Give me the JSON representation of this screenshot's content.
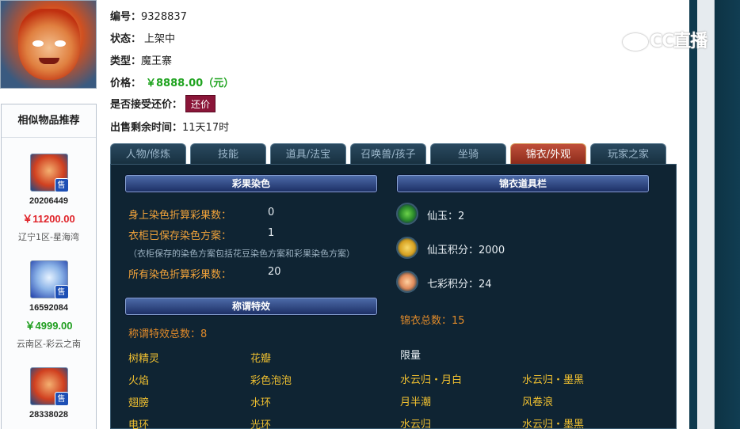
{
  "item": {
    "id_label": "编号：",
    "id_value": "9328837",
    "status_label": "状态：",
    "status_value": "上架中",
    "type_label": "类型：",
    "type_value": "魔王寨",
    "price_label": "价格：",
    "price_value": "￥8888.00（元）",
    "counter_label": "是否接受还价：",
    "counter_button": "还价",
    "time_label": "出售剩余时间：",
    "time_value": "11天17时"
  },
  "similar": {
    "title": "相似物品推荐",
    "items": [
      {
        "id": "20206449",
        "price": "￥11200.00",
        "server": "辽宁1区-星海湾",
        "badge": "售"
      },
      {
        "id": "16592084",
        "price": "￥4999.00",
        "server": "云南区-彩云之南",
        "badge": "售"
      },
      {
        "id": "28338028",
        "price": "",
        "server": "",
        "badge": "售"
      }
    ]
  },
  "tabs": [
    "人物/修炼",
    "技能",
    "道具/法宝",
    "召唤兽/孩子",
    "坐骑",
    "锦衣/外观",
    "玩家之家"
  ],
  "dye": {
    "title": "彩果染色",
    "rows": [
      {
        "label": "身上染色折算彩果数：",
        "value": "0"
      },
      {
        "label": "衣柜已保存染色方案：",
        "value": "1"
      },
      {
        "label": "所有染色折算彩果数：",
        "value": "20"
      }
    ],
    "note": "（衣柜保存的染色方案包括花豆染色方案和彩果染色方案）"
  },
  "title_fx": {
    "title": "称谓特效",
    "total": "称谓特效总数：8",
    "items": [
      "树精灵",
      "花瓣",
      "火焰",
      "彩色泡泡",
      "翅膀",
      "水环",
      "电环",
      "光环"
    ]
  },
  "wardrobe": {
    "title": "锦衣道具栏",
    "rows": [
      {
        "icon": "jade-icon",
        "label": "仙玉：2"
      },
      {
        "icon": "card-icon",
        "label": "仙玉积分：2000"
      },
      {
        "icon": "seven-color-icon",
        "label": "七彩积分：24"
      }
    ],
    "total": "锦衣总数：15",
    "limited_label": "限量",
    "limited_items": [
      "水云归・月白",
      "水云归・墨黑",
      "月半潮",
      "风卷浪",
      "水云归",
      "水云归・墨黑"
    ]
  },
  "watermark": "CC直播",
  "colors": {
    "panel_bg": "#0f2433",
    "accent_orange": "#f2a33a",
    "price_green": "#1fa31f",
    "price_red": "#e0242a",
    "tab_active": "#8a2a1a"
  }
}
